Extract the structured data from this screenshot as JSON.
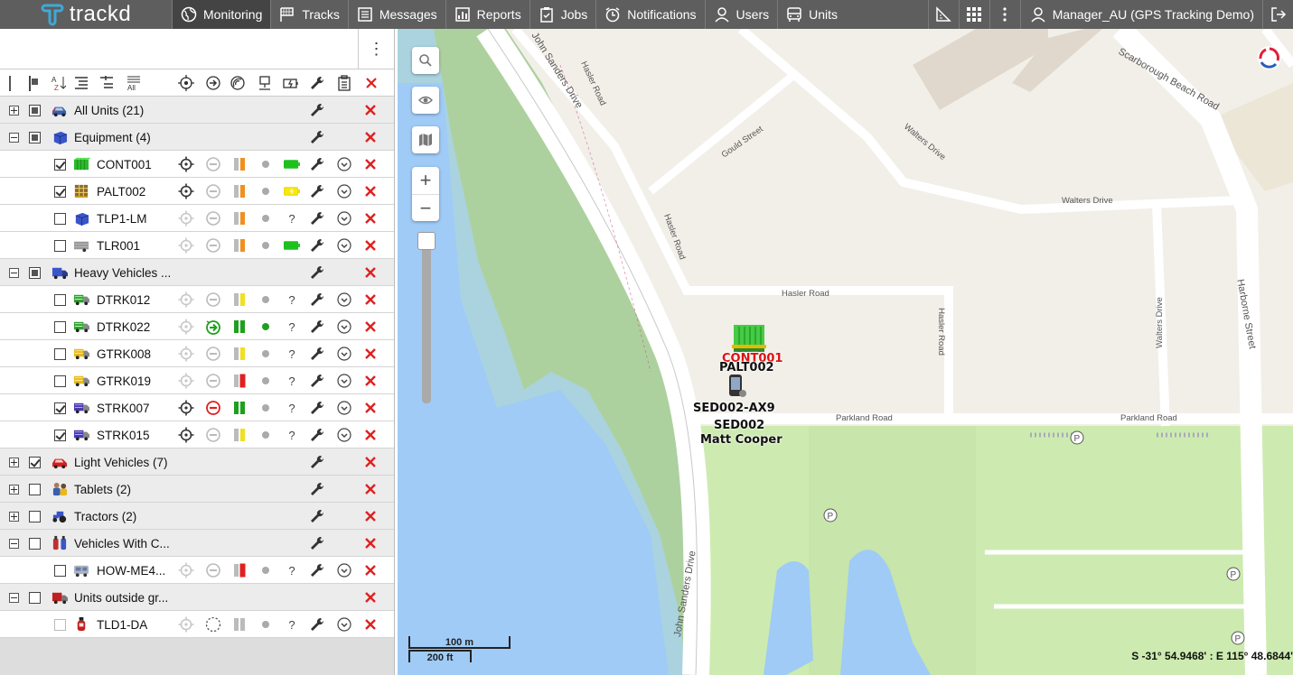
{
  "app": {
    "name": "trackd",
    "user": "Manager_AU (GPS Tracking Demo)"
  },
  "nav": [
    {
      "label": "Monitoring",
      "icon": "globe-icon"
    },
    {
      "label": "Tracks",
      "icon": "flag-icon"
    },
    {
      "label": "Messages",
      "icon": "messages-icon"
    },
    {
      "label": "Reports",
      "icon": "reports-icon"
    },
    {
      "label": "Jobs",
      "icon": "jobs-icon"
    },
    {
      "label": "Notifications",
      "icon": "alarm-icon"
    },
    {
      "label": "Users",
      "icon": "user-icon"
    },
    {
      "label": "Units",
      "icon": "bus-icon"
    }
  ],
  "groups": [
    {
      "name": "All Units (21)",
      "expanded": false,
      "check": "partial",
      "icon": "car-blue"
    },
    {
      "name": "Equipment (4)",
      "expanded": true,
      "check": "partial",
      "icon": "cube-blue",
      "units": [
        {
          "name": "CONT001",
          "checked": true,
          "icon": "container-green",
          "locate": "dark",
          "motion": "idle",
          "signal": "orange",
          "conn": "gray",
          "battery": "green"
        },
        {
          "name": "PALT002",
          "checked": true,
          "icon": "pallet",
          "locate": "dark",
          "motion": "idle",
          "signal": "orange",
          "conn": "gray",
          "battery": "yellow"
        },
        {
          "name": "TLP1-LM",
          "checked": false,
          "icon": "cube-blue",
          "locate": "light",
          "motion": "idle",
          "signal": "orange",
          "conn": "gray",
          "battery": "?"
        },
        {
          "name": "TLR001",
          "checked": false,
          "icon": "trailer",
          "locate": "light",
          "motion": "idle",
          "signal": "orange",
          "conn": "gray",
          "battery": "green"
        }
      ]
    },
    {
      "name": "Heavy Vehicles ...",
      "expanded": true,
      "check": "partial",
      "icon": "truck-blue",
      "units": [
        {
          "name": "DTRK012",
          "checked": false,
          "icon": "truck-green",
          "locate": "light",
          "motion": "idle",
          "signal": "yellow",
          "conn": "gray",
          "battery": "?"
        },
        {
          "name": "DTRK022",
          "checked": false,
          "icon": "truck-green",
          "locate": "light",
          "motion": "moving",
          "signal": "green",
          "conn": "green",
          "battery": "?"
        },
        {
          "name": "GTRK008",
          "checked": false,
          "icon": "truck-yellow",
          "locate": "light",
          "motion": "idle",
          "signal": "yellow",
          "conn": "gray",
          "battery": "?"
        },
        {
          "name": "GTRK019",
          "checked": false,
          "icon": "truck-yellow",
          "locate": "light",
          "motion": "idle",
          "signal": "red",
          "conn": "gray",
          "battery": "?"
        },
        {
          "name": "STRK007",
          "checked": true,
          "icon": "truck-purple",
          "locate": "dark",
          "motion": "stopped",
          "signal": "green",
          "conn": "gray",
          "battery": "?"
        },
        {
          "name": "STRK015",
          "checked": true,
          "icon": "truck-purple",
          "locate": "dark",
          "motion": "idle",
          "signal": "yellow",
          "conn": "gray",
          "battery": "?"
        }
      ]
    },
    {
      "name": "Light Vehicles (7)",
      "expanded": false,
      "check": "checked",
      "icon": "car-red"
    },
    {
      "name": "Tablets (2)",
      "expanded": false,
      "check": "none",
      "icon": "people"
    },
    {
      "name": "Tractors (2)",
      "expanded": false,
      "check": "none",
      "icon": "tractor"
    },
    {
      "name": "Vehicles With C...",
      "expanded": true,
      "check": "none",
      "icon": "bottles",
      "units": [
        {
          "name": "HOW-ME4...",
          "checked": false,
          "icon": "van",
          "locate": "light",
          "motion": "idle",
          "signal": "red",
          "conn": "gray",
          "battery": "?"
        }
      ]
    },
    {
      "name": "Units outside gr...",
      "expanded": true,
      "check": "none",
      "icon": "truck-red",
      "nowrench": true,
      "units": [
        {
          "name": "TLD1-DA",
          "checked": false,
          "disabled": true,
          "icon": "bottle-red",
          "locate": "light",
          "motion": "unknown",
          "signal": "gray",
          "conn": "gray",
          "battery": "?"
        }
      ]
    }
  ],
  "map": {
    "labels": {
      "cont": "CONT001",
      "palt": "PALT002",
      "sed_ax": "SED002-AX9",
      "sed": "SED002",
      "driver": "Matt Cooper"
    },
    "streets": {
      "john_sanders": "John Sanders Drive",
      "hasler": "Hasler Road",
      "gould": "Gould Street",
      "walters": "Walters Drive",
      "scarborough": "Scarborough Beach Road",
      "parkland": "Parkland Road",
      "harborne": "Harborne Street"
    },
    "scale_top": "100 m",
    "scale_bottom": "200 ft",
    "coordinates": "S -31° 54.9468' : E 115° 48.6844'"
  }
}
